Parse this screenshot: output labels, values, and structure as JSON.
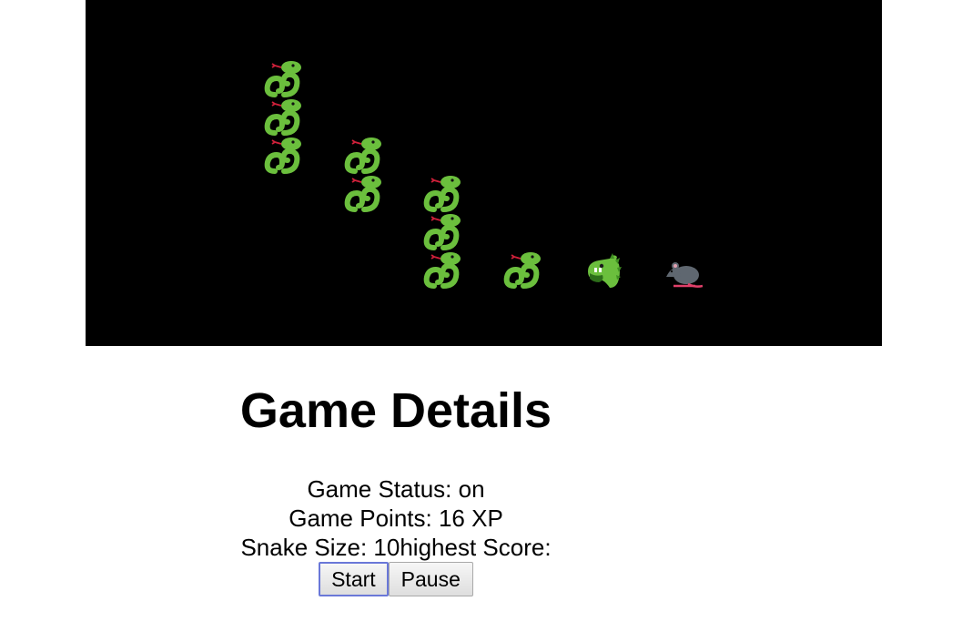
{
  "board": {
    "background": "#000000",
    "snake_icon": "snake-icon",
    "head_icon": "dragon-head-icon",
    "food_icon": "rat-icon",
    "snake_color": "#6bbf3d",
    "food_color": "#5f6770"
  },
  "details": {
    "title": "Game Details",
    "status_label": "Game Status: ",
    "status_value": "on",
    "points_label": "Game Points: ",
    "points_value": "16 XP",
    "size_label": "Snake Size: ",
    "size_value": "10",
    "highest_label": "highest Score:",
    "highest_value": ""
  },
  "controls": {
    "start_label": "Start",
    "pause_label": "Pause"
  }
}
